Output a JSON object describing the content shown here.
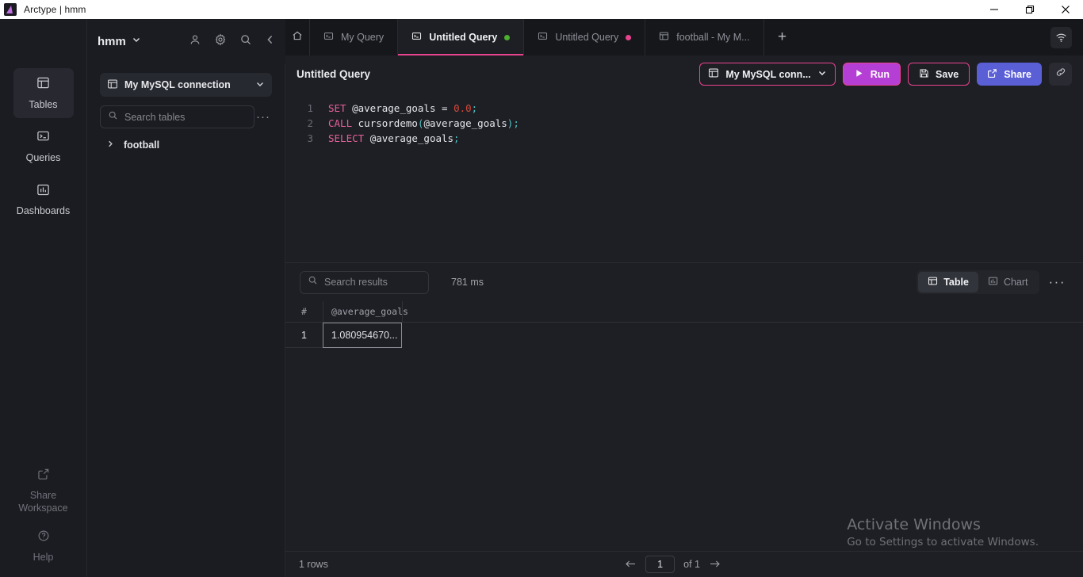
{
  "titlebar": {
    "app_title": "Arctype | hmm",
    "logo_icon": "arctype-logo-icon",
    "minimize_icon": "minimize-icon",
    "maximize_icon": "maximize-icon",
    "close_icon": "close-icon"
  },
  "rail": {
    "items": [
      {
        "label": "Tables",
        "icon": "tables-icon",
        "active": true
      },
      {
        "label": "Queries",
        "icon": "terminal-icon",
        "active": false
      },
      {
        "label": "Dashboards",
        "icon": "chart-bar-icon",
        "active": false
      }
    ],
    "bottom": [
      {
        "label_line1": "Share",
        "label_line2": "Workspace",
        "icon": "external-link-icon"
      },
      {
        "label_line1": "Help",
        "label_line2": "",
        "icon": "question-circle-icon"
      }
    ]
  },
  "workspace": {
    "name": "hmm",
    "caret_icon": "chevron-down-icon",
    "icons": [
      "user-icon",
      "gear-icon",
      "search-icon",
      "collapse-left-icon"
    ]
  },
  "sidebar": {
    "connection": {
      "label": "My MySQL connection",
      "icon": "database-icon",
      "caret_icon": "chevron-down-icon"
    },
    "search": {
      "placeholder": "Search tables",
      "value": "",
      "icon": "search-icon"
    },
    "more_label": "···",
    "tree": [
      {
        "label": "football",
        "expanded": false,
        "chevron_icon": "chevron-right-icon"
      }
    ]
  },
  "tabs": {
    "home_icon": "home-icon",
    "new_tab_label": "+",
    "items": [
      {
        "label": "My Query",
        "icon": "query-icon",
        "active": false,
        "dot": null
      },
      {
        "label": "Untitled Query",
        "icon": "query-icon",
        "active": true,
        "dot": "#4caf2f"
      },
      {
        "label": "Untitled Query",
        "icon": "query-icon",
        "active": false,
        "dot": "#e8438f"
      },
      {
        "label": "football - My M...",
        "icon": "table-icon",
        "active": false,
        "dot": null
      }
    ],
    "wifi_icon": "wifi-icon"
  },
  "query_header": {
    "title": "Untitled Query",
    "connection_label": "My MySQL conn...",
    "connection_icon": "database-icon",
    "connection_caret": "chevron-down-icon",
    "run_label": "Run",
    "run_icon": "play-icon",
    "save_label": "Save",
    "save_icon": "save-icon",
    "share_label": "Share",
    "share_icon": "external-link-icon",
    "link_icon": "link-icon"
  },
  "editor": {
    "lines": [
      {
        "no": "1",
        "tokens": [
          {
            "t": "SET",
            "c": "kw"
          },
          {
            "t": " ",
            "c": "op"
          },
          {
            "t": "@average_goals",
            "c": "id"
          },
          {
            "t": " ",
            "c": "op"
          },
          {
            "t": "=",
            "c": "op"
          },
          {
            "t": " ",
            "c": "op"
          },
          {
            "t": "0.0",
            "c": "num"
          },
          {
            "t": ";",
            "c": "punc"
          }
        ]
      },
      {
        "no": "2",
        "tokens": [
          {
            "t": "CALL",
            "c": "kw"
          },
          {
            "t": " ",
            "c": "op"
          },
          {
            "t": "cursordemo",
            "c": "fn"
          },
          {
            "t": "(",
            "c": "punc"
          },
          {
            "t": "@average_goals",
            "c": "id"
          },
          {
            "t": ")",
            "c": "punc"
          },
          {
            "t": ";",
            "c": "punc"
          }
        ]
      },
      {
        "no": "3",
        "tokens": [
          {
            "t": "SELECT",
            "c": "kw"
          },
          {
            "t": " ",
            "c": "op"
          },
          {
            "t": "@average_goals",
            "c": "id"
          },
          {
            "t": ";",
            "c": "punc"
          }
        ]
      }
    ]
  },
  "results": {
    "search": {
      "placeholder": "Search results",
      "value": "",
      "icon": "search-icon"
    },
    "duration": "781 ms",
    "view_table_label": "Table",
    "view_table_icon": "table-icon",
    "view_chart_label": "Chart",
    "view_chart_icon": "chart-bar-icon",
    "more_label": "···",
    "columns": [
      "#",
      "@average_goals"
    ],
    "rows": [
      {
        "index": "1",
        "value": "1.080954670..."
      }
    ]
  },
  "footer": {
    "rows_label": "1 rows",
    "prev_icon": "arrow-left-icon",
    "page_value": "1",
    "of_label": "of 1",
    "next_icon": "arrow-right-icon"
  },
  "watermark": {
    "line1": "Activate Windows",
    "line2": "Go to Settings to activate Windows."
  },
  "colors": {
    "accent_pink": "#e8438f",
    "run_purple": "#b53fd4",
    "share_indigo": "#5b5fd6",
    "bg": "#1e1f24",
    "panel": "#1b1c21",
    "tabstrip": "#16171b"
  }
}
